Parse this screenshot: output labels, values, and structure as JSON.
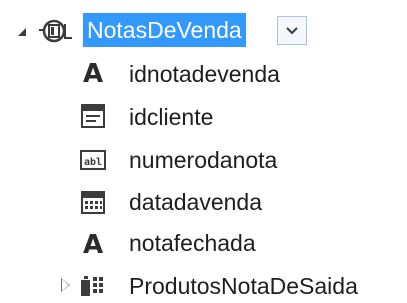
{
  "tree": {
    "root": {
      "label": "NotasDeVenda",
      "expanded": true,
      "selected": true,
      "icon": "entity-icon",
      "highlight_color": "#3399ff"
    },
    "children": [
      {
        "label": "idnotadevenda",
        "icon": "letter-a-icon"
      },
      {
        "label": "idcliente",
        "icon": "lookup-field-icon"
      },
      {
        "label": "numerodanota",
        "icon": "abl-textbox-icon"
      },
      {
        "label": "datadavenda",
        "icon": "calendar-icon"
      },
      {
        "label": "notafechada",
        "icon": "letter-a-icon"
      },
      {
        "label": "ProdutosNotaDeSaida",
        "icon": "navigation-collection-icon",
        "expanded": false
      }
    ]
  }
}
